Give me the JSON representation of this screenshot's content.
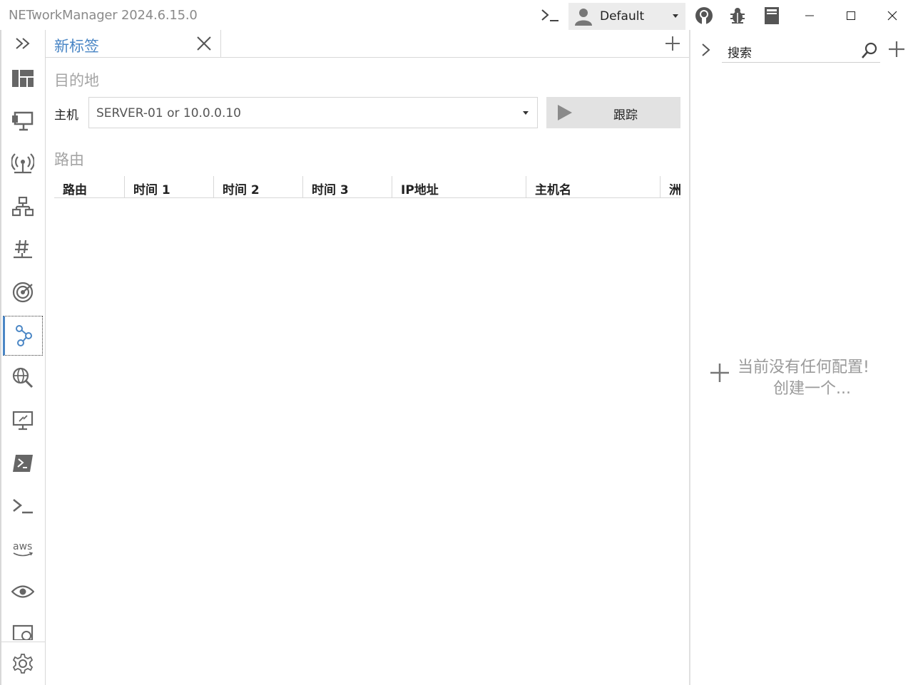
{
  "window": {
    "title": "NETworkManager 2024.6.15.0",
    "profile": "Default"
  },
  "tab": {
    "label": "新标签"
  },
  "destination": {
    "heading": "目的地",
    "host_label": "主机",
    "host_placeholder": "SERVER-01 or 10.0.0.10",
    "trace_label": "跟踪"
  },
  "route": {
    "heading": "路由",
    "columns": [
      "路由",
      "时间 1",
      "时间 2",
      "时间 3",
      "IP地址",
      "主机名",
      "洲"
    ]
  },
  "profiles_panel": {
    "search_placeholder": "搜索",
    "empty_line1": "当前没有任何配置!",
    "empty_line2": "创建一个..."
  },
  "sidebar_icons": [
    "dashboard-icon",
    "network-interface-icon",
    "wifi-icon",
    "ip-scanner-icon",
    "port-scanner-icon",
    "ping-monitor-icon",
    "traceroute-icon",
    "dns-lookup-icon",
    "remote-desktop-icon",
    "powershell-icon",
    "putty-icon",
    "aws-icon",
    "tightvnc-icon",
    "web-console-icon",
    "settings-icon"
  ],
  "colors": {
    "accent": "#4a86c5",
    "muted_text": "#a4a4a4",
    "button_bg": "#e2e2e2"
  }
}
